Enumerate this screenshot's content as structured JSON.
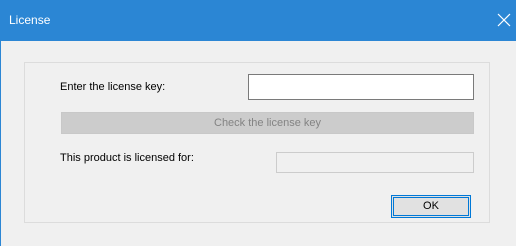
{
  "window": {
    "title": "License",
    "close_icon": "close-icon",
    "accent_color": "#2b86d4"
  },
  "form": {
    "key_label": "Enter the license key:",
    "key_value": "",
    "check_button_label": "Check the license key",
    "licensed_label": "This product is licensed for:",
    "licensed_value": "",
    "ok_button_label": "OK"
  }
}
